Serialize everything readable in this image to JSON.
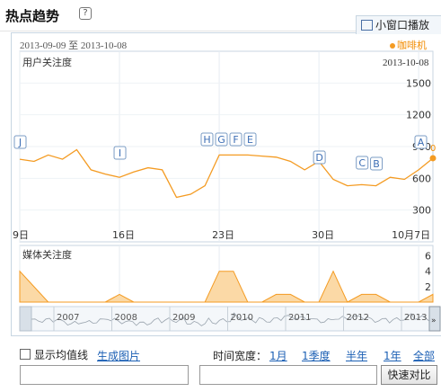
{
  "header": {
    "title": "热点趋势",
    "help_icon": "?",
    "popout_label": "小窗口播放"
  },
  "range": {
    "dates": "2013-09-09 至 2013-10-08"
  },
  "legend": {
    "series_name": "咖啡机",
    "color": "#f49b22"
  },
  "main_chart": {
    "label": "用户关注度",
    "date_label": "2013-10-08",
    "y_ticks": [
      "1500",
      "1200",
      "900",
      "600",
      "300"
    ],
    "x_ticks": [
      "9日",
      "16日",
      "23日",
      "30日",
      "10月7日"
    ],
    "current_marker": "0",
    "event_markers": [
      "J",
      "I",
      "H",
      "G",
      "F",
      "E",
      "D",
      "C",
      "B",
      "A"
    ]
  },
  "media_chart": {
    "label": "媒体关注度",
    "y_ticks": [
      "6",
      "4",
      "2"
    ]
  },
  "navigator": {
    "years": [
      "2007",
      "2008",
      "2009",
      "2010",
      "2011",
      "2012",
      "2013"
    ]
  },
  "controls": {
    "moving_avg_label": "显示均值线",
    "generate_image": "生成图片",
    "time_width_label": "时间宽度：",
    "time_options": [
      "1月",
      "1季度",
      "半年",
      "1年",
      "全部"
    ],
    "compare_button": "快速对比"
  },
  "chart_data": [
    {
      "type": "line",
      "title": "用户关注度",
      "series": [
        {
          "name": "咖啡机",
          "values": [
            780,
            760,
            820,
            780,
            870,
            680,
            640,
            610,
            660,
            700,
            680,
            420,
            450,
            530,
            820,
            820,
            820,
            810,
            800,
            760,
            680,
            760,
            590,
            530,
            540,
            530,
            610,
            590,
            680,
            790
          ]
        }
      ],
      "x": [
        "2013-09-09",
        "2013-09-10",
        "2013-09-11",
        "2013-09-12",
        "2013-09-13",
        "2013-09-14",
        "2013-09-15",
        "2013-09-16",
        "2013-09-17",
        "2013-09-18",
        "2013-09-19",
        "2013-09-20",
        "2013-09-21",
        "2013-09-22",
        "2013-09-23",
        "2013-09-24",
        "2013-09-25",
        "2013-09-26",
        "2013-09-27",
        "2013-09-28",
        "2013-09-29",
        "2013-09-30",
        "2013-10-01",
        "2013-10-02",
        "2013-10-03",
        "2013-10-04",
        "2013-10-05",
        "2013-10-06",
        "2013-10-07",
        "2013-10-08"
      ],
      "ylim": [
        0,
        1800
      ],
      "grid": true
    },
    {
      "type": "area",
      "title": "媒体关注度",
      "series": [
        {
          "name": "咖啡机",
          "values": [
            4,
            2,
            0,
            0,
            0,
            0,
            0,
            1,
            0,
            0,
            0,
            0,
            0,
            0,
            4,
            4,
            0,
            0,
            1,
            1,
            0,
            0,
            4,
            0,
            1,
            1,
            0,
            0,
            0,
            1
          ]
        }
      ],
      "ylim": [
        0,
        7
      ]
    }
  ]
}
